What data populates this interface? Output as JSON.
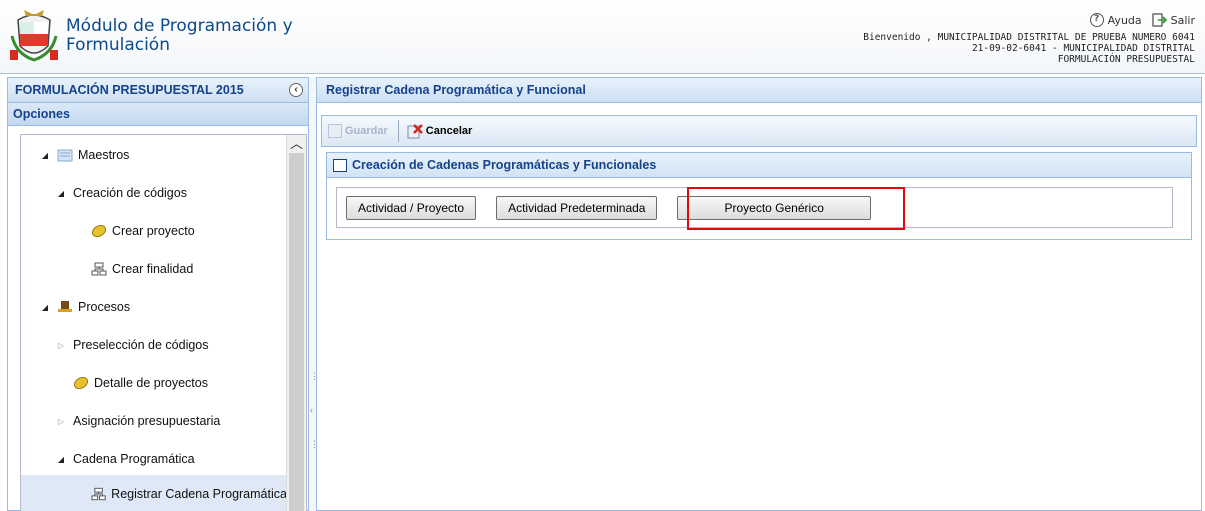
{
  "header": {
    "title": "Módulo de Programación y Formulación",
    "help_label": "Ayuda",
    "exit_label": "Salir",
    "welcome_line1": "Bienvenido , MUNICIPALIDAD DISTRITAL DE PRUEBA NUMERO 6041",
    "welcome_line2": "21-09-02-6041 - MUNICIPALIDAD DISTRITAL",
    "welcome_line3": "FORMULACIÓN PRESUPUESTAL"
  },
  "left_panel": {
    "title": "FORMULACIÓN PRESUPUESTAL 2015",
    "options_title": "Opciones",
    "tree": [
      {
        "label": "Maestros",
        "icon": "folder-icon",
        "expand": "open"
      },
      {
        "label": "Creación de códigos",
        "icon": "",
        "expand": "open"
      },
      {
        "label": "Crear proyecto",
        "icon": "project-icon",
        "expand": "none"
      },
      {
        "label": "Crear finalidad",
        "icon": "hierarchy-icon",
        "expand": "none"
      },
      {
        "label": "Procesos",
        "icon": "hat-icon",
        "expand": "open"
      },
      {
        "label": "Preselección de códigos",
        "icon": "",
        "expand": "closed"
      },
      {
        "label": "Detalle de proyectos",
        "icon": "project-icon",
        "expand": "none"
      },
      {
        "label": "Asignación presupuestaria",
        "icon": "",
        "expand": "closed"
      },
      {
        "label": "Cadena Programática",
        "icon": "",
        "expand": "open"
      },
      {
        "label": "Registrar Cadena Programática y",
        "icon": "hierarchy-icon",
        "expand": "none"
      }
    ]
  },
  "main": {
    "title": "Registrar Cadena Programática y Funcional",
    "toolbar": {
      "save_label": "Guardar",
      "cancel_label": "Cancelar"
    },
    "section_title": "Creación de Cadenas Programáticas y Funcionales",
    "buttons": {
      "activity_project": "Actividad / Proyecto",
      "default_activity": "Actividad Predeterminada",
      "generic_project": "Proyecto Genérico"
    }
  },
  "colors": {
    "panel_title": "#15428b",
    "panel_border": "#99bbe8",
    "highlight": "#e1080f"
  }
}
